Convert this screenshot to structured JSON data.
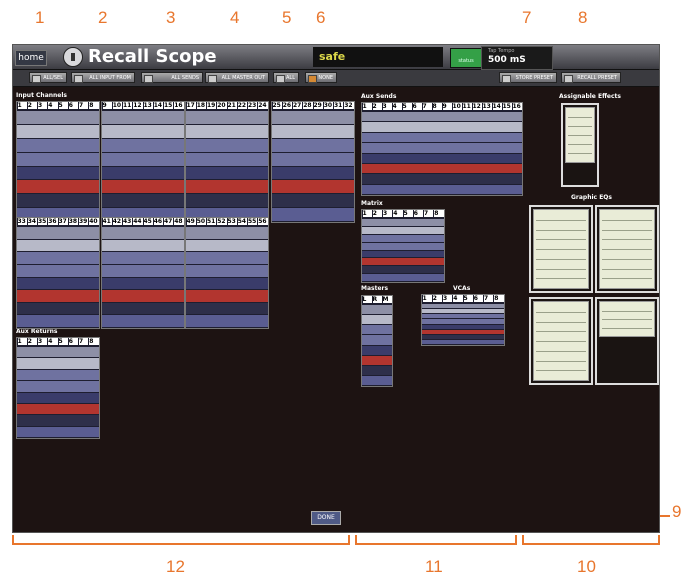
{
  "callouts": [
    "1",
    "2",
    "3",
    "4",
    "5",
    "6",
    "7",
    "8",
    "9",
    "10",
    "11",
    "12"
  ],
  "topbar": {
    "home_label": "home",
    "title": "Recall Scope",
    "safe_text": "safe",
    "status_label": "status",
    "tempo_label": "Tap Tempo",
    "tempo_value": "500 mS"
  },
  "toolbar": [
    {
      "label": "ALL/SEL"
    },
    {
      "label": "ALL INPUT FROM"
    },
    {
      "label": "ALL SENDS"
    },
    {
      "label": "ALL MASTER OUT"
    },
    {
      "label": "ALL"
    },
    {
      "label": "NONE"
    },
    {
      "label": "STORE PRESET"
    },
    {
      "label": "RECALL PRESET"
    }
  ],
  "sections": {
    "input_channels": "Input Channels",
    "aux_returns": "Aux Returns",
    "aux_sends": "Aux Sends",
    "matrix": "Matrix",
    "masters": "Masters",
    "vcas": "VCAs",
    "assignable_effects": "Assignable Effects",
    "graphic_eqs": "Graphic EQs"
  },
  "input_numbers": [
    [
      "1",
      "2",
      "3",
      "4",
      "5",
      "6",
      "7",
      "8"
    ],
    [
      "9",
      "10",
      "11",
      "12",
      "13",
      "14",
      "15",
      "16"
    ],
    [
      "17",
      "18",
      "19",
      "20",
      "21",
      "22",
      "23",
      "24"
    ],
    [
      "25",
      "26",
      "27",
      "28",
      "29",
      "30",
      "31",
      "32"
    ],
    [
      "33",
      "34",
      "35",
      "36",
      "37",
      "38",
      "39",
      "40"
    ],
    [
      "41",
      "42",
      "43",
      "44",
      "45",
      "46",
      "47",
      "48"
    ],
    [
      "49",
      "50",
      "51",
      "52",
      "53",
      "54",
      "55",
      "56"
    ]
  ],
  "aux_send_numbers": [
    "1",
    "2",
    "3",
    "4",
    "5",
    "6",
    "7",
    "8",
    "9",
    "10",
    "11",
    "12",
    "13",
    "14",
    "15",
    "16"
  ],
  "matrix_numbers": [
    "1",
    "2",
    "3",
    "4",
    "5",
    "6",
    "7",
    "8"
  ],
  "master_labels": [
    "L",
    "R",
    "M"
  ],
  "vca_numbers": [
    "1",
    "2",
    "3",
    "4",
    "5",
    "6",
    "7",
    "8"
  ],
  "aux_return_numbers": [
    "1",
    "2",
    "3",
    "4",
    "5",
    "6",
    "7",
    "8"
  ],
  "done_label": "DONE",
  "colors": {
    "accent": "#e8762d",
    "background": "#1d1312"
  }
}
